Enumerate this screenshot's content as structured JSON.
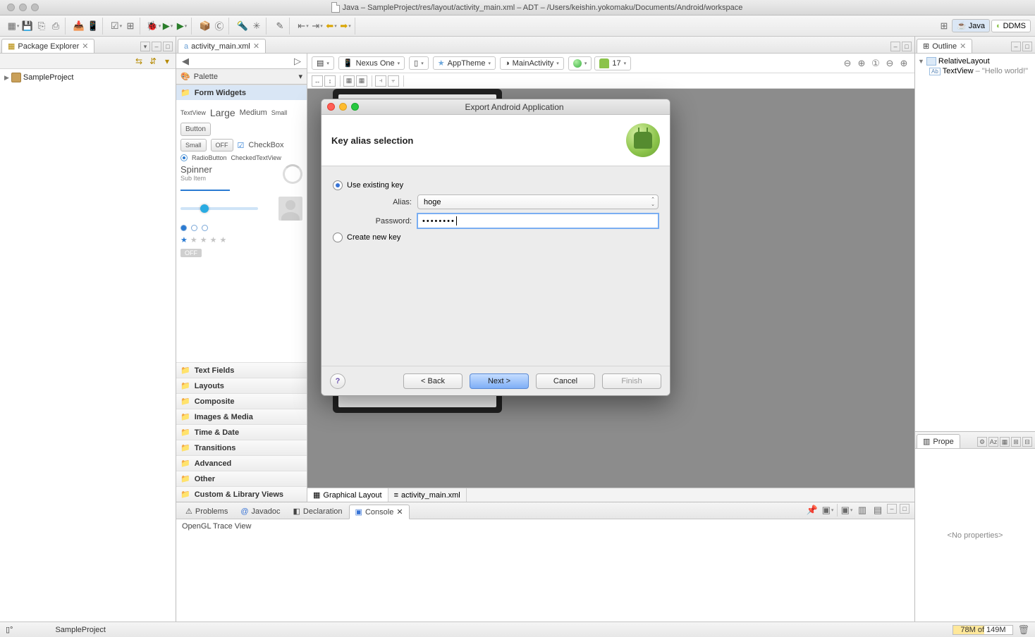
{
  "window": {
    "title": "Java – SampleProject/res/layout/activity_main.xml – ADT – /Users/keishin.yokomaku/Documents/Android/workspace"
  },
  "perspectives": {
    "java": "Java",
    "ddms": "DDMS"
  },
  "package_explorer": {
    "title": "Package Explorer",
    "project": "SampleProject"
  },
  "editor": {
    "tab": "activity_main.xml",
    "palette_title": "Palette",
    "categories": {
      "form_widgets": "Form Widgets",
      "text_fields": "Text Fields",
      "layouts": "Layouts",
      "composite": "Composite",
      "images_media": "Images & Media",
      "time_date": "Time & Date",
      "transitions": "Transitions",
      "advanced": "Advanced",
      "other": "Other",
      "custom": "Custom & Library Views"
    },
    "form_widgets": {
      "textview": "TextView",
      "large": "Large",
      "medium": "Medium",
      "small": "Small",
      "button": "Button",
      "small_btn": "Small",
      "off": "OFF",
      "checkbox": "CheckBox",
      "radiobutton": "RadioButton",
      "checkedtextview": "CheckedTextView",
      "spinner": "Spinner",
      "subitem": "Sub Item",
      "off_chip": "OFF"
    },
    "bottom_tabs": {
      "graphical": "Graphical Layout",
      "xml": "activity_main.xml"
    },
    "config": {
      "device": "Nexus One",
      "theme": "AppTheme",
      "activity": "MainActivity",
      "api": "17"
    }
  },
  "outline": {
    "title": "Outline",
    "root": "RelativeLayout",
    "child": "TextView",
    "child_desc": " – \"Hello world!\""
  },
  "properties": {
    "title": "Prope",
    "empty": "<No properties>"
  },
  "bottom_views": {
    "problems": "Problems",
    "javadoc": "Javadoc",
    "declaration": "Declaration",
    "console": "Console",
    "body": "OpenGL Trace View"
  },
  "status": {
    "project": "SampleProject",
    "mem": "78M of 149M"
  },
  "dialog": {
    "title": "Export Android Application",
    "heading": "Key alias selection",
    "use_existing": "Use existing key",
    "create_new": "Create new key",
    "alias_label": "Alias:",
    "alias_value": "hoge",
    "password_label": "Password:",
    "password_value": "••••••••",
    "back": "< Back",
    "next": "Next >",
    "cancel": "Cancel",
    "finish": "Finish",
    "help": "?"
  }
}
